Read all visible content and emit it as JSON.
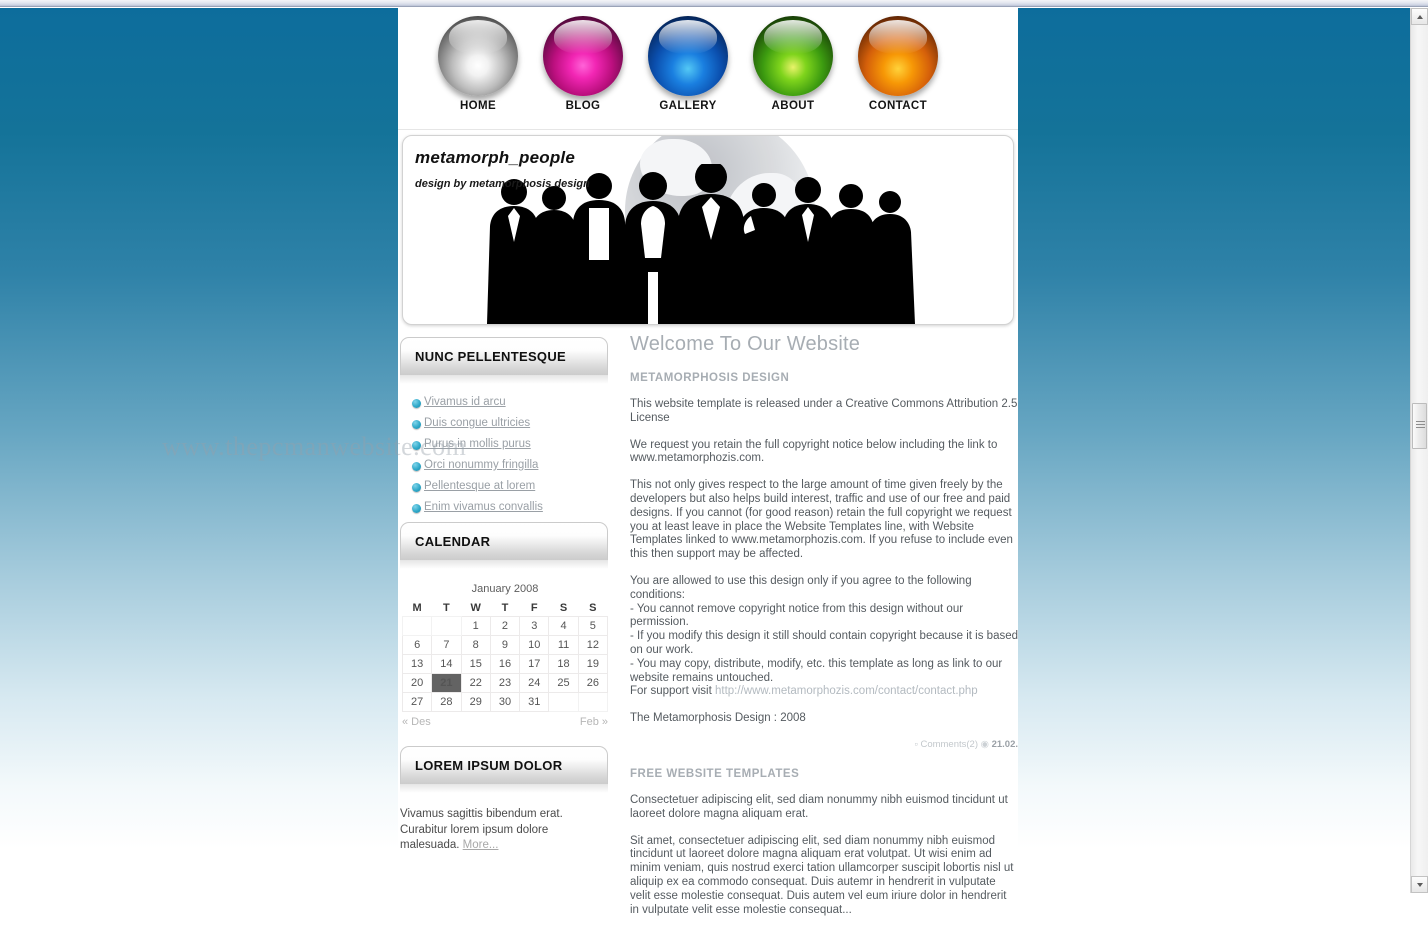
{
  "nav": {
    "items": [
      {
        "label": "HOME",
        "orb": "silver",
        "color": "#d9d9d9"
      },
      {
        "label": "BLOG",
        "orb": "magenta",
        "color": "#d6119b"
      },
      {
        "label": "GALLERY",
        "orb": "blue",
        "color": "#0b63c8"
      },
      {
        "label": "ABOUT",
        "orb": "green",
        "color": "#2f9e15"
      },
      {
        "label": "CONTACT",
        "orb": "orange",
        "color": "#e2740a"
      }
    ]
  },
  "banner": {
    "title": "metamorph_people",
    "subtitle": "design by metamorphosis design"
  },
  "watermark": "www.thepcmanwebsite.com",
  "sidebar": {
    "links_panel": {
      "heading": "NUNC PELLENTESQUE",
      "links": [
        "Vivamus id arcu",
        "Duis congue ultricies",
        "Purus in mollis purus",
        "Orci nonummy fringilla",
        "Pellentesque at lorem",
        "Enim vivamus convallis"
      ]
    },
    "calendar_panel": {
      "heading": "CALENDAR",
      "caption": "January 2008",
      "daynames": [
        "M",
        "T",
        "W",
        "T",
        "F",
        "S",
        "S"
      ],
      "weeks": [
        [
          "",
          "",
          "1",
          "2",
          "3",
          "4",
          "5"
        ],
        [
          "6",
          "7",
          "8",
          "9",
          "10",
          "11",
          "12"
        ],
        [
          "13",
          "14",
          "15",
          "16",
          "17",
          "18",
          "19"
        ],
        [
          "20",
          "21",
          "22",
          "23",
          "24",
          "25",
          "26"
        ],
        [
          "27",
          "28",
          "29",
          "30",
          "31",
          "",
          ""
        ]
      ],
      "today": "21",
      "prev_label": "« Des",
      "next_label": "Feb »"
    },
    "lorem_panel": {
      "heading": "LOREM IPSUM DOLOR",
      "text": "Vivamus sagittis bibendum erat. Curabitur lorem ipsum dolore malesuada. ",
      "more_label": "More..."
    }
  },
  "main": {
    "title": "Welcome To Our Website",
    "section1_heading": "METAMORPHOSIS DESIGN",
    "p1": "This website template is released under a Creative Commons Attribution 2.5 License",
    "p2": "We request you retain the full copyright notice below including the link to www.metamorphozis.com.",
    "p3": "This not only gives respect to the large amount of time given freely by the developers but also helps build interest, traffic and use of our free and paid designs. If you cannot (for good reason) retain the full copyright we request you at least leave in place the Website Templates line, with Website Templates linked to www.metamorphozis.com. If you refuse to include even this then support may be affected.",
    "p4": "You are allowed to use this design only if you agree to the following conditions:",
    "p5": "- You cannot remove copyright notice from this design without our permission.",
    "p6": "- If you modify this design it still should contain copyright because it is based on our work.",
    "p7": "- You may copy, distribute, modify, etc. this template as long as link to our website remains untouched.",
    "support_prefix": "For support visit ",
    "support_url": "http://www.metamorphozis.com/contact/contact.php",
    "p8": "The Metamorphosis Design : 2008",
    "meta_comments": "Comments(2)",
    "meta_time": "21.02.",
    "section2_heading": "FREE WEBSITE TEMPLATES",
    "p9": "Consectetuer adipiscing elit, sed diam nonummy nibh euismod tincidunt ut laoreet dolore magna aliquam erat.",
    "p10": "Sit amet, consectetuer adipiscing elit, sed diam nonummy nibh euismod tincidunt ut laoreet dolore magna aliquam erat volutpat. Ut wisi enim ad minim veniam, quis nostrud exerci tation ullamcorper suscipit lobortis nisl ut aliquip ex ea commodo consequat. Duis autemr in hendrerit in vulputate velit esse molestie consequat. Duis autem vel eum iriure dolor in hendrerit in vulputate velit esse molestie consequat..."
  },
  "theme": {
    "bg_top": "#0d6d9c",
    "bg_bottom": "#ffffff",
    "bullet": "#2fa9c9",
    "today_bg": "#636363",
    "today_border": "#8c3a3a"
  }
}
